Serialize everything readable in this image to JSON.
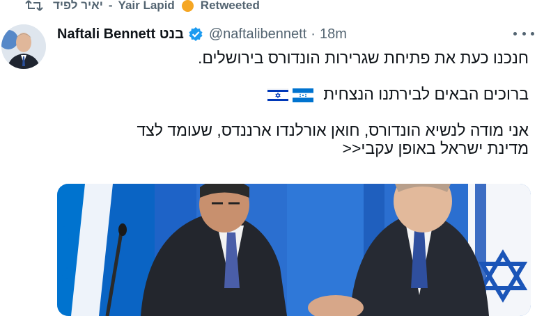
{
  "retweet": {
    "icon": "retweet-icon",
    "user_hebrew": "יאיר לפיד",
    "user_english": "Yair Lapid",
    "dot_color": "#f5a623",
    "label": "Retweeted"
  },
  "tweet": {
    "author_name": "Naftali Bennett בנט",
    "verified_icon": "verified-badge-icon",
    "handle": "@naftalibennett",
    "separator": "·",
    "time": "18m",
    "more_icon": "more-dots-icon",
    "lines": [
      "חנכנו כעת את פתיחת שגרירות הונדורס בירושלים.",
      "ברוכים הבאים לבירתנו הנצחית",
      "אני מודה לנשיא הונדורס, חואן אורלנדו ארננדס, שעומד לצד",
      "מדינת ישראל באופן עקבי<<"
    ],
    "flag_icons": [
      "honduras-flag-icon",
      "israel-flag-icon"
    ]
  },
  "colors": {
    "text": "#0f1419",
    "secondary": "#536471",
    "verified": "#1d9bf0",
    "flag_blue": "#0038b8",
    "honduras_blue": "#0073cf"
  }
}
